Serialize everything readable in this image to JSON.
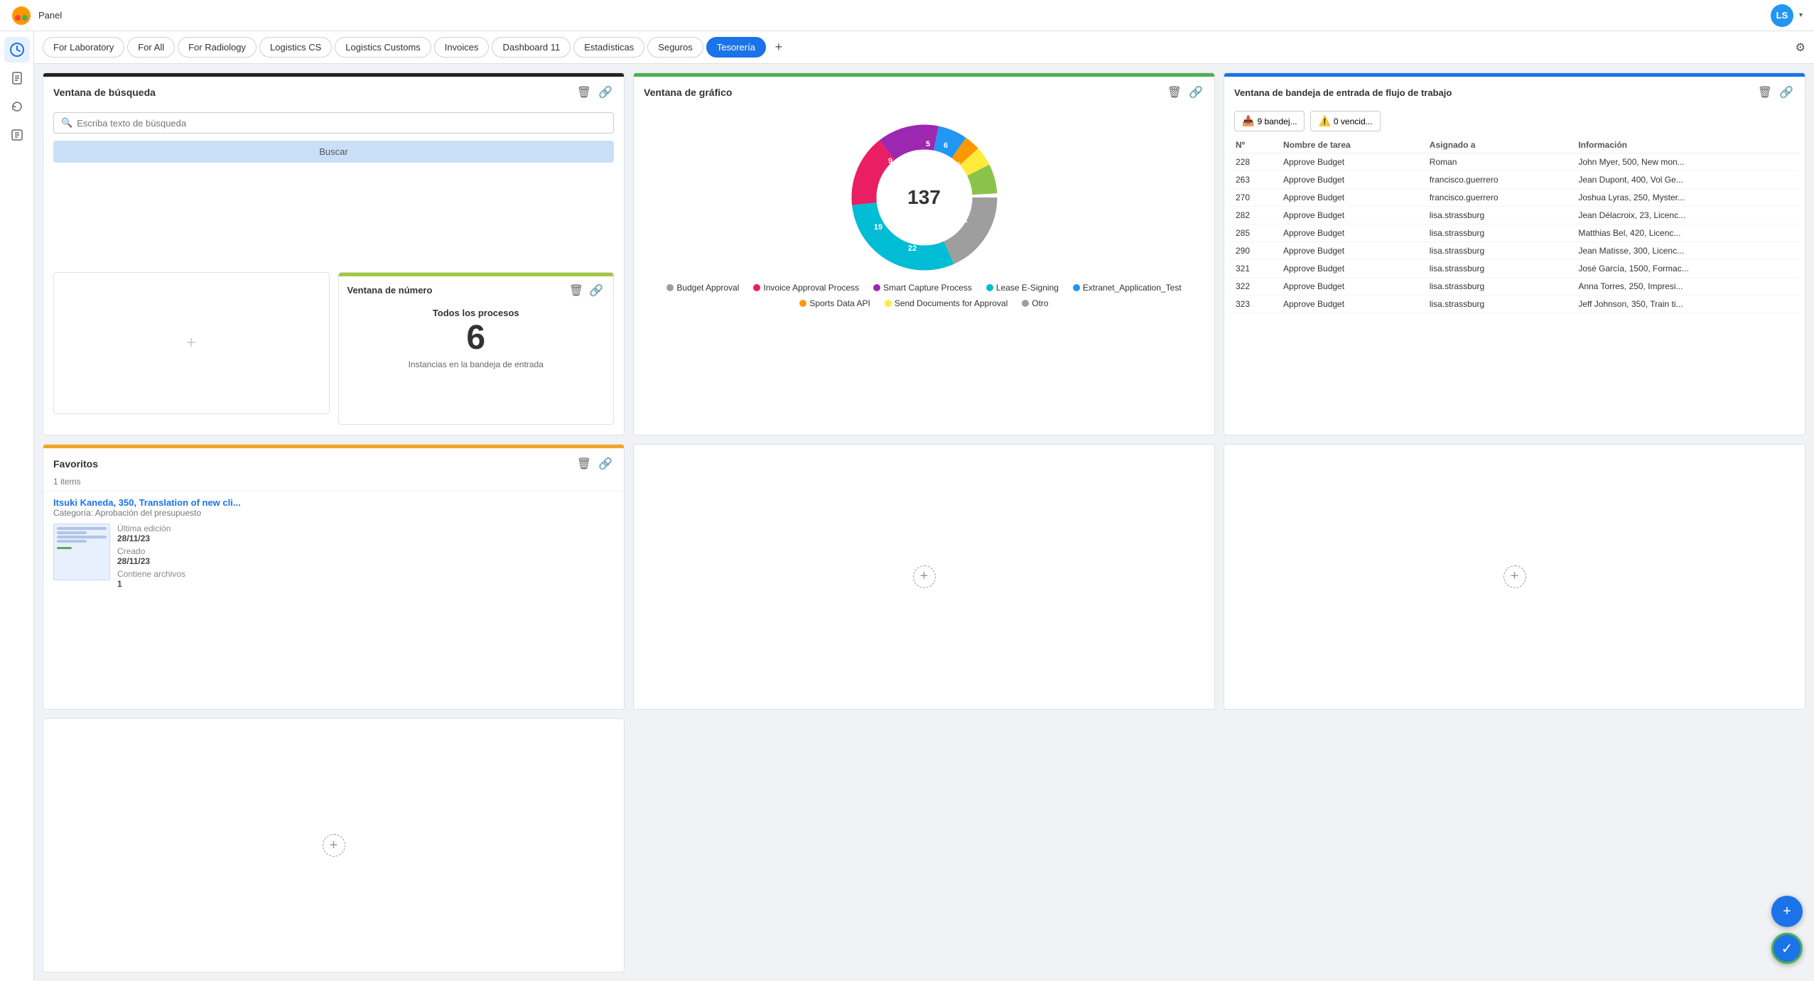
{
  "app": {
    "title": "Panel",
    "user_initials": "LS"
  },
  "tabs": [
    {
      "id": "for-laboratory",
      "label": "For Laboratory"
    },
    {
      "id": "for-all",
      "label": "For All"
    },
    {
      "id": "for-radiology",
      "label": "For Radiology"
    },
    {
      "id": "logistics-cs",
      "label": "Logistics CS"
    },
    {
      "id": "logistics-customs",
      "label": "Logistics Customs"
    },
    {
      "id": "invoices",
      "label": "Invoices"
    },
    {
      "id": "dashboard-11",
      "label": "Dashboard 11"
    },
    {
      "id": "estadisticas",
      "label": "Estadísticas"
    },
    {
      "id": "seguros",
      "label": "Seguros"
    },
    {
      "id": "tesoreria",
      "label": "Tesorería"
    }
  ],
  "sidebar": {
    "items": [
      {
        "id": "clock",
        "icon": "🕐",
        "label": "Recent"
      },
      {
        "id": "document",
        "icon": "📄",
        "label": "Documents"
      },
      {
        "id": "refresh",
        "icon": "🔄",
        "label": "Processes"
      },
      {
        "id": "tasks",
        "icon": "📋",
        "label": "Tasks"
      }
    ]
  },
  "search_widget": {
    "title": "Ventana de búsqueda",
    "search_placeholder": "Escriba texto de búsqueda",
    "search_btn_label": "Buscar"
  },
  "number_widget": {
    "title": "Ventana de número",
    "subtitle": "Todos los procesos",
    "number": "6",
    "description": "Instancias en la bandeja de entrada"
  },
  "graph_widget": {
    "title": "Ventana de gráfico",
    "total": "137",
    "segments": [
      {
        "label": "Budget Approval",
        "value": 26,
        "color": "#9e9e9e",
        "angle": 68
      },
      {
        "label": "Invoice Approval Process",
        "value": 41,
        "color": "#00bcd4",
        "angle": 107
      },
      {
        "label": "Smart Capture Process",
        "value": 22,
        "color": "#e91e63",
        "angle": 58
      },
      {
        "label": "Lease E-Signing",
        "value": 19,
        "color": "#9c27b0",
        "angle": 50
      },
      {
        "label": "Extranet_Application_Test",
        "value": 9,
        "color": "#2196f3",
        "angle": 24
      },
      {
        "label": "Sports Data API",
        "value": 5,
        "color": "#ff9800",
        "angle": 13
      },
      {
        "label": "Send Documents for Approval",
        "value": 6,
        "color": "#ffeb3b",
        "angle": 16
      },
      {
        "label": "Otro",
        "value": 9,
        "color": "#8bc34a",
        "angle": 24
      }
    ],
    "legend": [
      {
        "label": "Budget Approval",
        "color": "#9e9e9e"
      },
      {
        "label": "Invoice Approval Process",
        "color": "#e91e63"
      },
      {
        "label": "Smart Capture Process",
        "color": "#9c27b0"
      },
      {
        "label": "Lease E-Signing",
        "color": "#00bcd4"
      },
      {
        "label": "Extranet_Application_Test",
        "color": "#2196f3"
      },
      {
        "label": "Sports Data API",
        "color": "#ff9800"
      },
      {
        "label": "Send Documents for Approval",
        "color": "#ffeb3b"
      },
      {
        "label": "Otro",
        "color": "#9e9e9e"
      }
    ]
  },
  "inbox_widget": {
    "title": "Ventana de bandeja de entrada de flujo de trabajo",
    "filter_btns": [
      {
        "id": "inbox-btn",
        "label": "9 bandej...",
        "icon": "📥"
      },
      {
        "id": "expired-btn",
        "label": "0 vencid...",
        "icon": "⚠️"
      }
    ],
    "columns": [
      "Nº",
      "Nombre de tarea",
      "Asignado a",
      "Información"
    ],
    "rows": [
      {
        "num": "228",
        "task": "Approve Budget",
        "assigned": "Roman",
        "info": "John Myer, 500, New mon..."
      },
      {
        "num": "263",
        "task": "Approve Budget",
        "assigned": "francisco.guerrero",
        "info": "Jean Dupont, 400, Vol Ge..."
      },
      {
        "num": "270",
        "task": "Approve Budget",
        "assigned": "francisco.guerrero",
        "info": "Joshua Lyras, 250, Myster..."
      },
      {
        "num": "282",
        "task": "Approve Budget",
        "assigned": "lisa.strassburg",
        "info": "Jean Délacroix, 23, Licenc..."
      },
      {
        "num": "285",
        "task": "Approve Budget",
        "assigned": "lisa.strassburg",
        "info": "Matthias Bel, 420, Licenc..."
      },
      {
        "num": "290",
        "task": "Approve Budget",
        "assigned": "lisa.strassburg",
        "info": "Jean Matisse, 300, Licenc..."
      },
      {
        "num": "321",
        "task": "Approve Budget",
        "assigned": "lisa.strassburg",
        "info": "José García, 1500, Formac..."
      },
      {
        "num": "322",
        "task": "Approve Budget",
        "assigned": "lisa.strassburg",
        "info": "Anna Torres, 250, Impresi..."
      },
      {
        "num": "323",
        "task": "Approve Budget",
        "assigned": "lisa.strassburg",
        "info": "Jeff Johnson, 350, Train ti..."
      }
    ]
  },
  "favorites_widget": {
    "title": "Favoritos",
    "count": "1 items",
    "item": {
      "title": "Itsuki Kaneda, 350, Translation of new cli...",
      "category": "Categoría: Aprobación del presupuesto",
      "last_edit_label": "Última edición",
      "last_edit_value": "28/11/23",
      "created_label": "Creado",
      "created_value": "28/11/23",
      "files_label": "Contiene archivos",
      "files_value": "1"
    }
  },
  "fab": {
    "add_label": "+",
    "check_label": "✓"
  }
}
